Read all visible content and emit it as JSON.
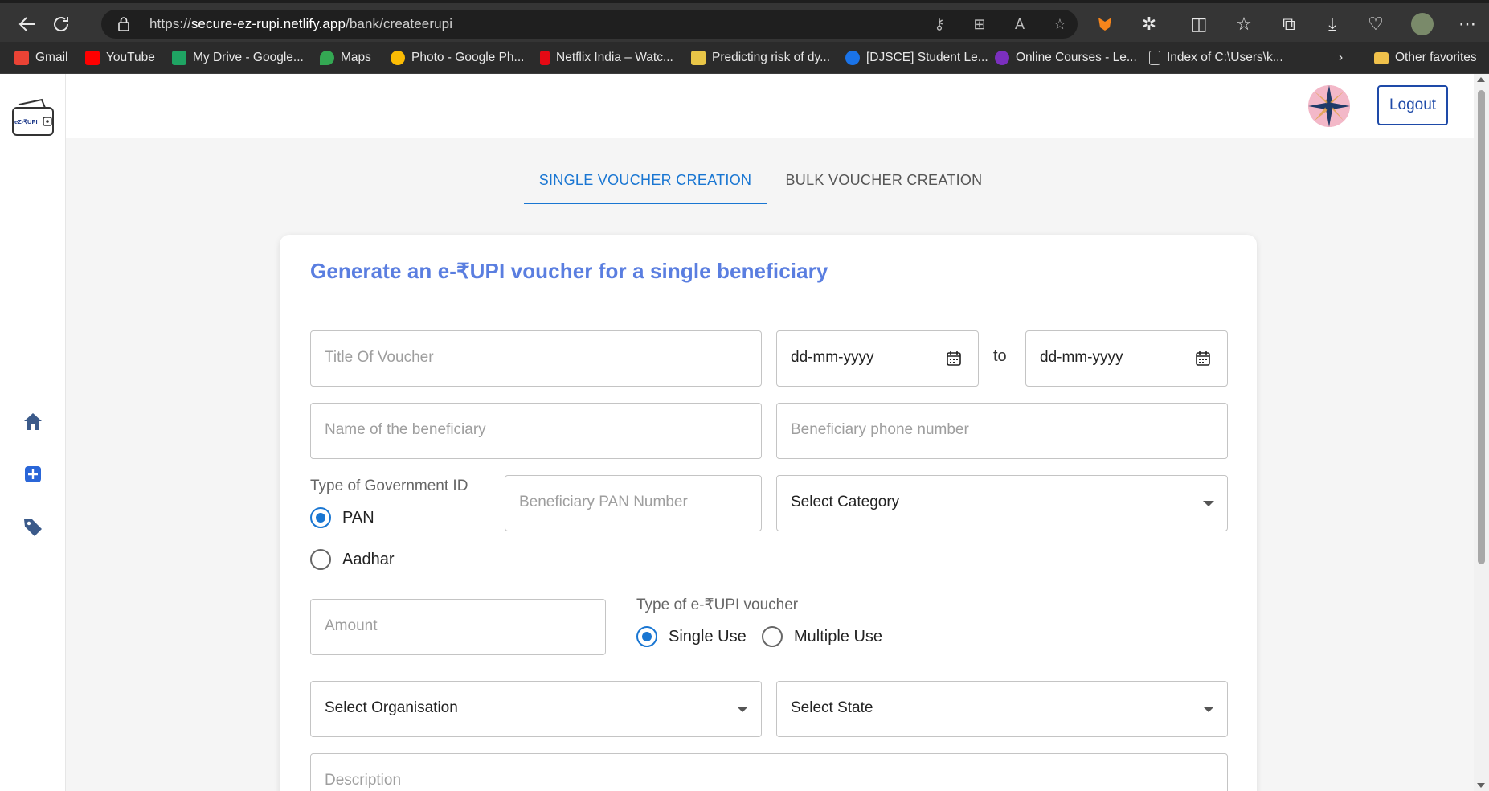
{
  "browser": {
    "url_prefix": "https://",
    "url_host": "secure-ez-rupi.netlify.app",
    "url_path": "/bank/createerupi",
    "bookmarks": [
      {
        "label": "Gmail",
        "color": "#ea4335"
      },
      {
        "label": "YouTube",
        "color": "#ff0000"
      },
      {
        "label": "My Drive - Google...",
        "color": "#1fa463"
      },
      {
        "label": "Maps",
        "color": "#34a853"
      },
      {
        "label": "Photo - Google Ph...",
        "color": "#fbbc04"
      },
      {
        "label": "Netflix India – Watc...",
        "color": "#e50914"
      },
      {
        "label": "Predicting risk of dy...",
        "color": "#e8c547"
      },
      {
        "label": "[DJSCE] Student Le...",
        "color": "#1a73e8"
      },
      {
        "label": "Online Courses - Le...",
        "color": "#7b2fbe"
      },
      {
        "label": "Index of C:\\Users\\k...",
        "color": "#cccccc"
      },
      {
        "label": "Other favorites",
        "color": "#f0c14b"
      }
    ]
  },
  "app": {
    "logo_text": "eZ-₹UPI",
    "logout_label": "Logout",
    "sidebar_icons": [
      "home-icon",
      "add-icon",
      "tag-icon"
    ]
  },
  "tabs": {
    "single": "SINGLE VOUCHER CREATION",
    "bulk": "BULK VOUCHER CREATION"
  },
  "form": {
    "title": "Generate an e-₹UPI voucher for a single beneficiary",
    "voucher_title_placeholder": "Title Of Voucher",
    "date_from": "dd-mm-yyyy",
    "date_to": "dd-mm-yyyy",
    "to_label": "to",
    "beneficiary_name_placeholder": "Name of the beneficiary",
    "beneficiary_phone_placeholder": "Beneficiary phone number",
    "gov_id_label": "Type of Government ID",
    "gov_id_options": [
      {
        "label": "PAN",
        "selected": true
      },
      {
        "label": "Aadhar",
        "selected": false
      }
    ],
    "pan_placeholder": "Beneficiary PAN Number",
    "category_select": "Select Category",
    "amount_placeholder": "Amount",
    "voucher_type_label": "Type of e-₹UPI voucher",
    "voucher_type_options": [
      {
        "label": "Single Use",
        "selected": true
      },
      {
        "label": "Multiple Use",
        "selected": false
      }
    ],
    "organisation_select": "Select Organisation",
    "state_select": "Select State",
    "description_placeholder": "Description"
  },
  "colors": {
    "accent": "#1976d2",
    "title": "#5a7ee0",
    "logout": "#1e4aa8"
  }
}
